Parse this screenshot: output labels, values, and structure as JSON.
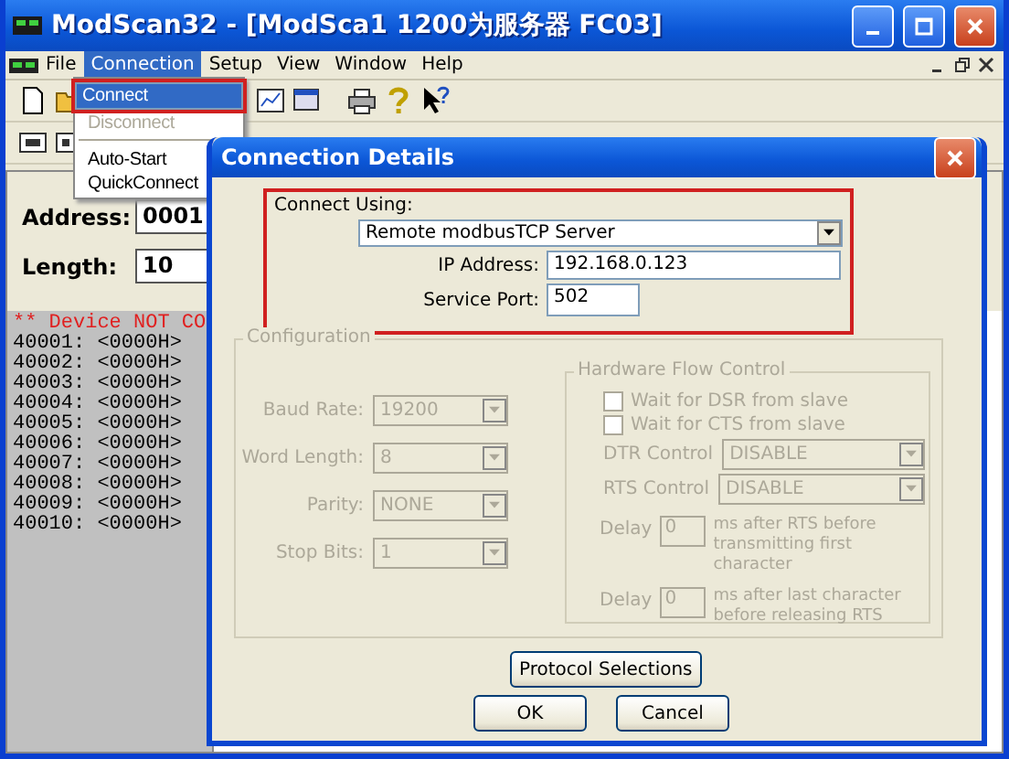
{
  "window": {
    "title": "ModScan32 - [ModSca1 1200为服务器 FC03]"
  },
  "menu_bar": [
    {
      "label": "File",
      "selected": false
    },
    {
      "label": "Connection",
      "selected": true
    },
    {
      "label": "Setup",
      "selected": false
    },
    {
      "label": "View",
      "selected": false
    },
    {
      "label": "Window",
      "selected": false
    },
    {
      "label": "Help",
      "selected": false
    }
  ],
  "menu": [
    {
      "kind": "item",
      "label": "Connect",
      "selected": true,
      "disabled": false
    },
    {
      "kind": "item",
      "label": "Disconnect",
      "selected": false,
      "disabled": true
    },
    {
      "kind": "separator"
    },
    {
      "kind": "item",
      "label": "Auto-Start",
      "selected": false,
      "disabled": false
    },
    {
      "kind": "item",
      "label": "QuickConnect",
      "selected": false,
      "disabled": false
    }
  ],
  "address": {
    "label": "Address:",
    "value": "0001"
  },
  "length": {
    "label": "Length:",
    "value": "10"
  },
  "status": "** Device NOT CO",
  "registers": [
    "40001: <0000H>",
    "40002: <0000H>",
    "40003: <0000H>",
    "40004: <0000H>",
    "40005: <0000H>",
    "40006: <0000H>",
    "40007: <0000H>",
    "40008: <0000H>",
    "40009: <0000H>",
    "40010: <0000H>"
  ],
  "dialog": {
    "title": "Connection Details",
    "connect_using": {
      "label": "Connect Using:",
      "value": "Remote modbusTCP Server"
    },
    "ip": {
      "label": "IP Address:",
      "value": "192.168.0.123"
    },
    "port": {
      "label": "Service Port:",
      "value": "502"
    },
    "configuration": {
      "title": "Configuration",
      "disabled": true,
      "fields": [
        {
          "label": "Baud Rate:",
          "value": "19200"
        },
        {
          "label": "Word Length:",
          "value": "8"
        },
        {
          "label": "Parity:",
          "value": "NONE"
        },
        {
          "label": "Stop Bits:",
          "value": "1"
        }
      ]
    },
    "flow_control": {
      "title": "Hardware Flow Control",
      "disabled": true,
      "checkboxes": [
        {
          "label": "Wait for DSR from slave",
          "checked": false
        },
        {
          "label": "Wait for CTS from slave",
          "checked": false
        }
      ],
      "selects": [
        {
          "label": "DTR Control",
          "value": "DISABLE"
        },
        {
          "label": "RTS Control",
          "value": "DISABLE"
        }
      ],
      "delays": [
        {
          "label": "Delay",
          "value": "0",
          "note": "ms after RTS before transmitting first character"
        },
        {
          "label": "Delay",
          "value": "0",
          "note": "ms after last character before releasing RTS"
        }
      ]
    },
    "protocol_button": "Protocol Selections",
    "buttons": [
      "OK",
      "Cancel"
    ]
  }
}
